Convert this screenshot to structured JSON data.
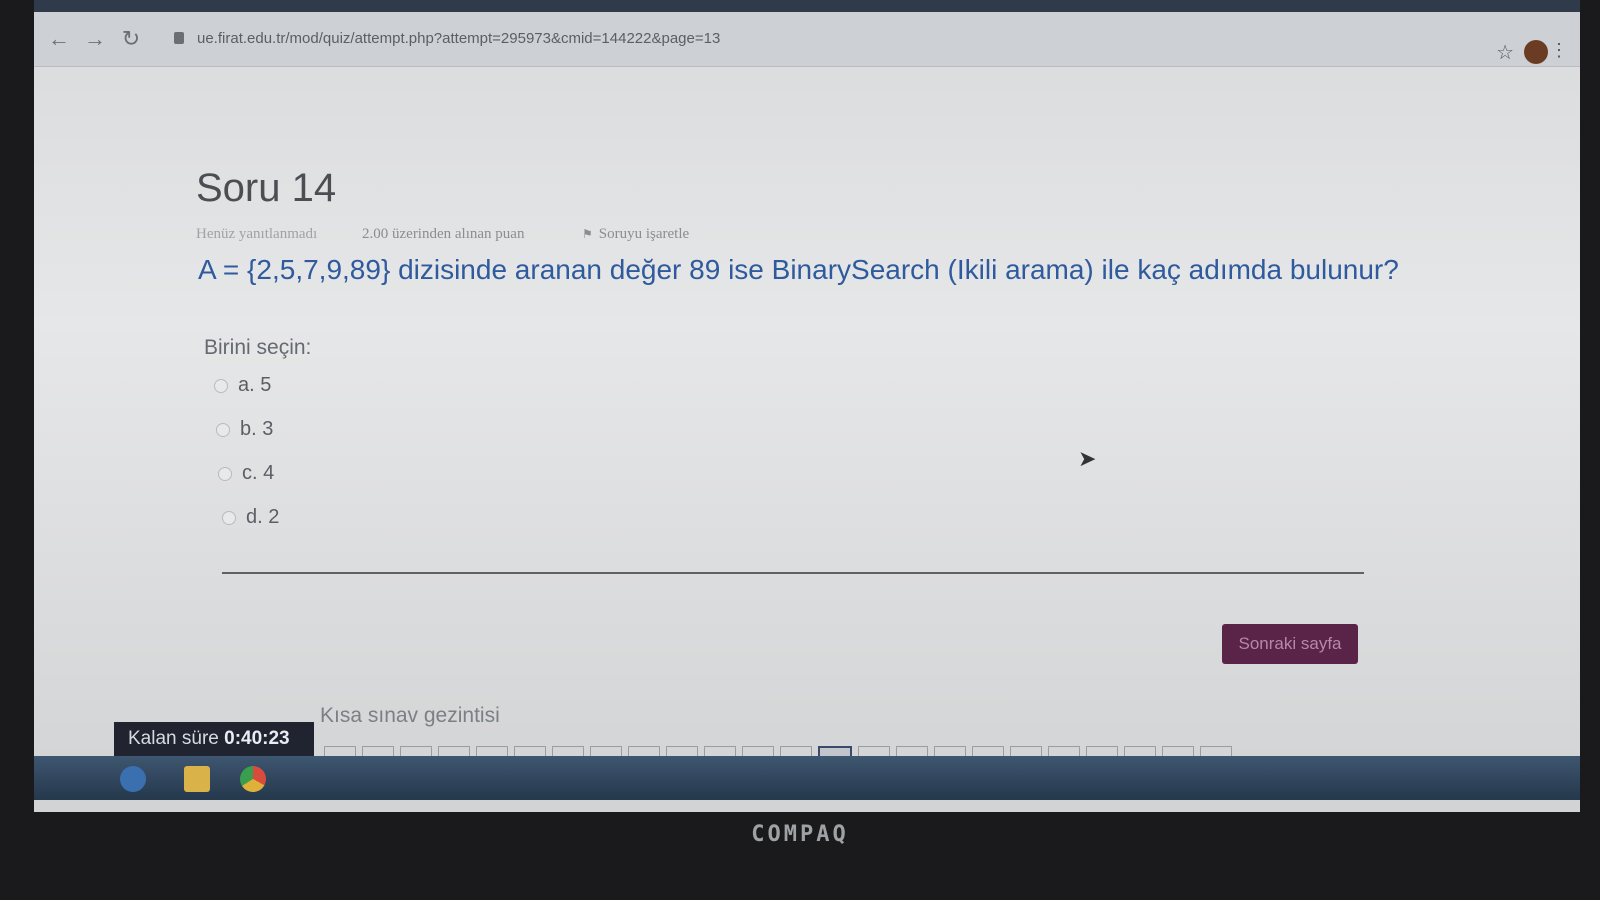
{
  "browser": {
    "url": "ue.firat.edu.tr/mod/quiz/attempt.php?attempt=295973&cmid=144222&page=13"
  },
  "question": {
    "title": "Soru 14",
    "status": "Henüz yanıtlanmadı",
    "grade": "2.00 üzerinden alınan puan",
    "flag_label": "Soruyu işaretle",
    "text": "A = {2,5,7,9,89} dizisinde aranan değer 89 ise BinarySearch (Ikili arama) ile kaç adımda bulunur?",
    "prompt": "Birini seçin:",
    "options": [
      {
        "label": "a. 5"
      },
      {
        "label": "b. 3"
      },
      {
        "label": "c. 4"
      },
      {
        "label": "d. 2"
      }
    ]
  },
  "footer": {
    "next_label": "Sonraki sayfa",
    "nav_heading": "Kısa sınav gezintisi",
    "timer_label": "Kalan süre",
    "timer_value": "0:40:23"
  },
  "device": {
    "brand": "COMPAQ"
  },
  "colors": {
    "accent": "#5a2348",
    "question_text": "#2f5b9e"
  }
}
